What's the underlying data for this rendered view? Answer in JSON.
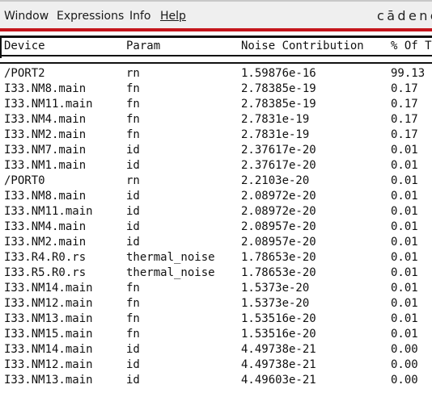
{
  "menu": {
    "items": [
      "Window",
      "Expressions",
      "Info",
      "Help"
    ],
    "logo": "cādence"
  },
  "table": {
    "headers": [
      "Device",
      "Param",
      "Noise Contribution",
      "% Of To"
    ],
    "rows": [
      [
        "/PORT2",
        "rn",
        "1.59876e-16",
        "99.13"
      ],
      [
        "I33.NM8.main",
        "fn",
        "2.78385e-19",
        "0.17"
      ],
      [
        "I33.NM11.main",
        "fn",
        "2.78385e-19",
        "0.17"
      ],
      [
        "I33.NM4.main",
        "fn",
        "2.7831e-19",
        "0.17"
      ],
      [
        "I33.NM2.main",
        "fn",
        "2.7831e-19",
        "0.17"
      ],
      [
        "I33.NM7.main",
        "id",
        "2.37617e-20",
        "0.01"
      ],
      [
        "I33.NM1.main",
        "id",
        "2.37617e-20",
        "0.01"
      ],
      [
        "/PORT0",
        "rn",
        "2.2103e-20",
        "0.01"
      ],
      [
        "I33.NM8.main",
        "id",
        "2.08972e-20",
        "0.01"
      ],
      [
        "I33.NM11.main",
        "id",
        "2.08972e-20",
        "0.01"
      ],
      [
        "I33.NM4.main",
        "id",
        "2.08957e-20",
        "0.01"
      ],
      [
        "I33.NM2.main",
        "id",
        "2.08957e-20",
        "0.01"
      ],
      [
        "I33.R4.R0.rs",
        "thermal_noise",
        "1.78653e-20",
        "0.01"
      ],
      [
        "I33.R5.R0.rs",
        "thermal_noise",
        "1.78653e-20",
        "0.01"
      ],
      [
        "I33.NM14.main",
        "fn",
        "1.5373e-20",
        "0.01"
      ],
      [
        "I33.NM12.main",
        "fn",
        "1.5373e-20",
        "0.01"
      ],
      [
        "I33.NM13.main",
        "fn",
        "1.53516e-20",
        "0.01"
      ],
      [
        "I33.NM15.main",
        "fn",
        "1.53516e-20",
        "0.01"
      ],
      [
        "I33.NM14.main",
        "id",
        "4.49738e-21",
        "0.00"
      ],
      [
        "I33.NM12.main",
        "id",
        "4.49738e-21",
        "0.00"
      ],
      [
        "I33.NM13.main",
        "id",
        "4.49603e-21",
        "0.00"
      ]
    ]
  }
}
